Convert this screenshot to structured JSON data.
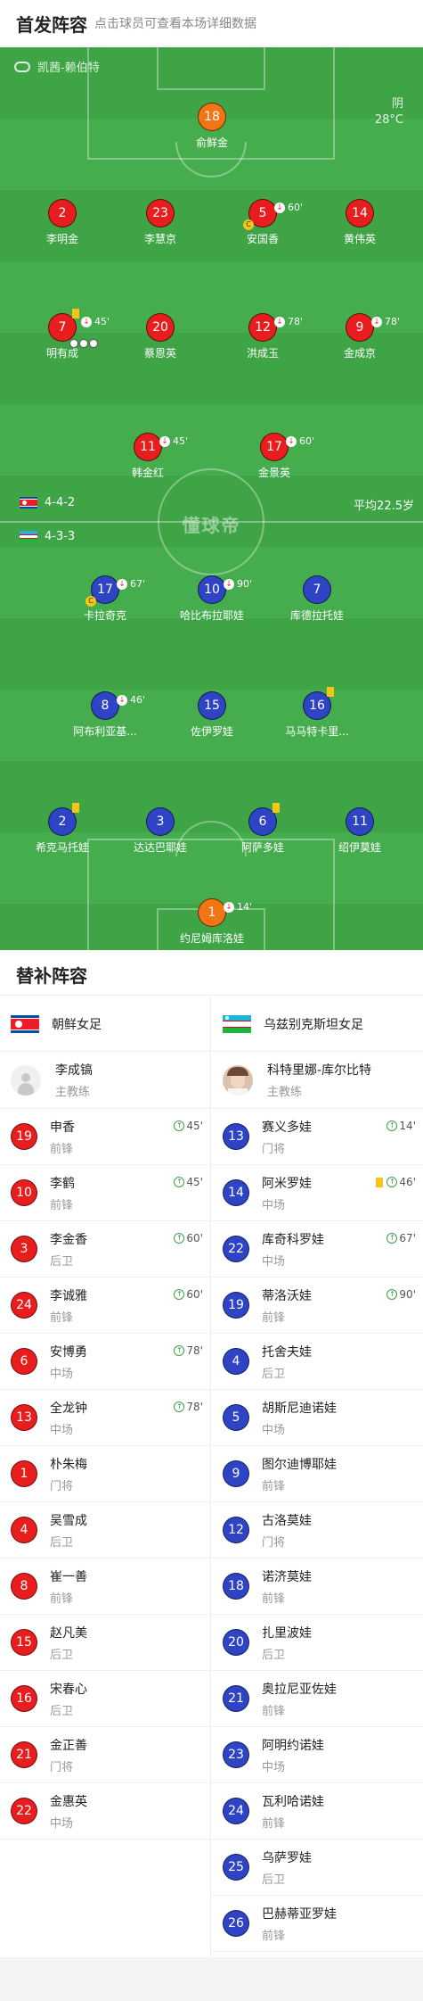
{
  "header": {
    "title": "首发阵容",
    "subtitle": "点击球员可查看本场详细数据"
  },
  "pitch": {
    "venue": "凯茜-赖伯特",
    "weather": "阴",
    "temperature": "28°C",
    "watermark": "懂球帝",
    "home_formation": "4-4-2",
    "away_formation": "4-3-3",
    "avg_age": "平均22.5岁"
  },
  "home_players": [
    {
      "num": "18",
      "name": "俞鲜金",
      "gk": true
    },
    {
      "num": "2",
      "name": "李明金"
    },
    {
      "num": "23",
      "name": "李慧京"
    },
    {
      "num": "5",
      "name": "安国香",
      "sub": "60'",
      "yellow_small": true
    },
    {
      "num": "14",
      "name": "黄伟英"
    },
    {
      "num": "7",
      "name": "明有成",
      "sub": "45'",
      "yellow": true,
      "balls": 3
    },
    {
      "num": "20",
      "name": "蔡恩英"
    },
    {
      "num": "12",
      "name": "洪成玉",
      "sub": "78'"
    },
    {
      "num": "9",
      "name": "金成京",
      "sub": "78'"
    },
    {
      "num": "11",
      "name": "韩金红",
      "sub": "45'"
    },
    {
      "num": "17",
      "name": "金景英",
      "sub": "60'"
    }
  ],
  "away_players": [
    {
      "num": "17",
      "name": "卡拉奇克",
      "sub": "67'",
      "yellow_small": true
    },
    {
      "num": "10",
      "name": "哈比布拉耶娃",
      "sub": "90'"
    },
    {
      "num": "7",
      "name": "库德拉托娃"
    },
    {
      "num": "8",
      "name": "阿布利亚基...",
      "sub": "46'"
    },
    {
      "num": "15",
      "name": "佐伊罗娃"
    },
    {
      "num": "16",
      "name": "马马特卡里...",
      "yellow": true
    },
    {
      "num": "2",
      "name": "希克马托娃",
      "yellow": true
    },
    {
      "num": "3",
      "name": "达达巴耶娃"
    },
    {
      "num": "6",
      "name": "阿萨多娃",
      "yellow": true
    },
    {
      "num": "11",
      "name": "绍伊莫娃"
    },
    {
      "num": "1",
      "name": "约尼姆库洛娃",
      "gk": true,
      "sub": "14'"
    }
  ],
  "subs": {
    "title": "替补阵容",
    "home": {
      "team": "朝鲜女足",
      "coach": {
        "name": "李成镐",
        "role": "主教练"
      },
      "players": [
        {
          "num": "19",
          "name": "申香",
          "pos": "前锋",
          "sub": "45'"
        },
        {
          "num": "10",
          "name": "李鹤",
          "pos": "前锋",
          "sub": "45'"
        },
        {
          "num": "3",
          "name": "李金香",
          "pos": "后卫",
          "sub": "60'"
        },
        {
          "num": "24",
          "name": "李诚雅",
          "pos": "前锋",
          "sub": "60'"
        },
        {
          "num": "6",
          "name": "安博勇",
          "pos": "中场",
          "sub": "78'"
        },
        {
          "num": "13",
          "name": "全龙钟",
          "pos": "中场",
          "sub": "78'"
        },
        {
          "num": "1",
          "name": "朴朱梅",
          "pos": "门将"
        },
        {
          "num": "4",
          "name": "吴雪成",
          "pos": "后卫"
        },
        {
          "num": "8",
          "name": "崔一善",
          "pos": "前锋"
        },
        {
          "num": "15",
          "name": "赵凡美",
          "pos": "后卫"
        },
        {
          "num": "16",
          "name": "宋春心",
          "pos": "后卫"
        },
        {
          "num": "21",
          "name": "金正善",
          "pos": "门将"
        },
        {
          "num": "22",
          "name": "金惠英",
          "pos": "中场"
        }
      ]
    },
    "away": {
      "team": "乌兹别克斯坦女足",
      "coach": {
        "name": "科特里娜-库尔比特",
        "role": "主教练"
      },
      "players": [
        {
          "num": "13",
          "name": "赛义多娃",
          "pos": "门将",
          "sub": "14'"
        },
        {
          "num": "14",
          "name": "阿米罗娃",
          "pos": "中场",
          "sub": "46'",
          "yellow": true
        },
        {
          "num": "22",
          "name": "库奇科罗娃",
          "pos": "中场",
          "sub": "67'"
        },
        {
          "num": "19",
          "name": "蒂洛沃娃",
          "pos": "前锋",
          "sub": "90'"
        },
        {
          "num": "4",
          "name": "托舍夫娃",
          "pos": "后卫"
        },
        {
          "num": "5",
          "name": "胡斯尼迪诺娃",
          "pos": "中场"
        },
        {
          "num": "9",
          "name": "图尔迪博耶娃",
          "pos": "前锋"
        },
        {
          "num": "12",
          "name": "古洛莫娃",
          "pos": "门将"
        },
        {
          "num": "18",
          "name": "诺济莫娃",
          "pos": "前锋"
        },
        {
          "num": "20",
          "name": "扎里波娃",
          "pos": "后卫"
        },
        {
          "num": "21",
          "name": "奥拉尼亚佐娃",
          "pos": "前锋"
        },
        {
          "num": "23",
          "name": "阿明约诺娃",
          "pos": "中场"
        },
        {
          "num": "24",
          "name": "瓦利哈诺娃",
          "pos": "前锋"
        },
        {
          "num": "25",
          "name": "乌萨罗娃",
          "pos": "后卫"
        },
        {
          "num": "26",
          "name": "巴赫蒂亚罗娃",
          "pos": "前锋"
        }
      ]
    }
  }
}
